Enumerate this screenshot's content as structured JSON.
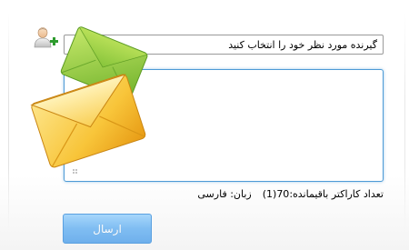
{
  "form": {
    "recipient_select": {
      "selected": "گیرنده مورد نظر خود را انتخاب کنید"
    },
    "message": {
      "value": ""
    },
    "counter": {
      "label": "تعداد کاراکتر باقیمانده:",
      "value": "70(1)",
      "language_label": "زبان:",
      "language_value": "فارسی"
    },
    "send_label": "ارسال"
  },
  "icons": {
    "add_user": "add-user-icon",
    "envelope_back": "green-envelope-icon",
    "envelope_front": "yellow-envelope-icon",
    "dropdown": "chevron-down-icon",
    "resize": "resize-grip-icon"
  },
  "colors": {
    "button_accent": "#7fbdf2",
    "textarea_focus": "#4e9bd6",
    "envelope_green": "#8cc63f",
    "envelope_yellow": "#f6c12b"
  }
}
